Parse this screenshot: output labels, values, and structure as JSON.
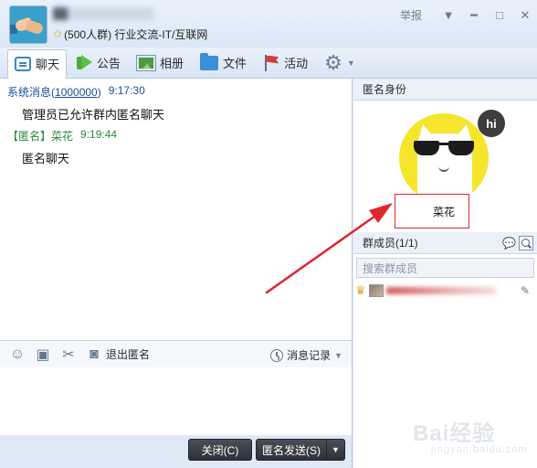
{
  "titlebar": {
    "group_subtitle": "(500人群) 行业交流-IT/互联网",
    "report_label": "举报",
    "icons": [
      "star-icon",
      "chevron-down-icon",
      "minimize-icon",
      "maximize-icon",
      "close-icon"
    ]
  },
  "toolbar": {
    "tabs": [
      {
        "label": "聊天",
        "icon": "chat-icon",
        "active": true
      },
      {
        "label": "公告",
        "icon": "megaphone-icon"
      },
      {
        "label": "相册",
        "icon": "album-icon"
      },
      {
        "label": "文件",
        "icon": "folder-icon"
      },
      {
        "label": "活动",
        "icon": "flag-icon"
      }
    ]
  },
  "chat": {
    "messages": [
      {
        "sender": "系统消息",
        "sender_id": "1000000",
        "time": "9:17:30",
        "text": "管理员已允许群内匿名聊天"
      },
      {
        "sender": "【匿名】菜花",
        "time": "9:19:44",
        "text": "匿名聊天"
      }
    ]
  },
  "input_toolbar": {
    "exit_anonymous": "退出匿名",
    "history": "消息记录"
  },
  "bottom": {
    "close_label": "关闭(C)",
    "send_label": "匿名发送(S)"
  },
  "right_panel": {
    "identity_title": "匿名身份",
    "avatar_bubble": "hi",
    "anon_name": "菜花",
    "members_title": "群成员(1/1)",
    "member_search_placeholder": "搜索群成员"
  },
  "watermark": {
    "main": "Bai经验",
    "sub": "jingyan.baidu.com"
  },
  "colors": {
    "accent_blue": "#1b4fa0",
    "anon_green": "#2d8a3e",
    "highlight_red": "#d9262b",
    "avatar_yellow": "#f5e52c"
  }
}
